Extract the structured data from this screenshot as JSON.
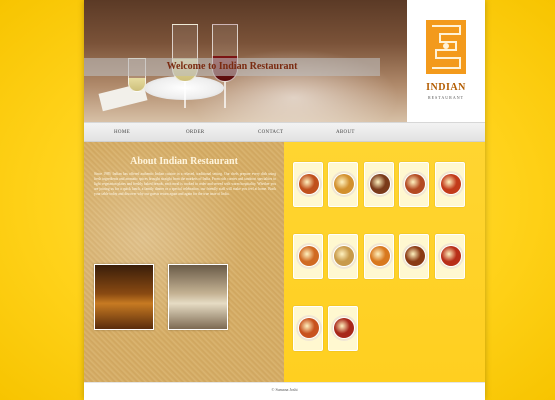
{
  "header": {
    "welcome": "Welcome to Indian Restaurant",
    "logo_title": "INDIAN",
    "logo_sub": "RESTAURANT"
  },
  "nav": {
    "items": [
      {
        "label": "HOME"
      },
      {
        "label": "ORDER"
      },
      {
        "label": "CONTACT"
      },
      {
        "label": "ABOUT"
      }
    ]
  },
  "about": {
    "title": "About Indian Restaurant",
    "text": "Since 1989, Indian has offered authentic Indian cuisine in a relaxed, traditional setting. Our chefs prepare every dish using fresh ingredients and aromatic spices brought straight from the markets of India. From rich curries and tandoori specialties to light vegetarian plates and freshly baked breads, each meal is cooked to order and served with warm hospitality. Whether you are joining us for a quick lunch, a family dinner or a special celebration, our friendly staff will make you feel at home. Book your table today and discover why our guests return again and again for the true taste of India."
  },
  "gallery": {
    "dishes": [
      {
        "name": "dish-1",
        "color": "#c0501c"
      },
      {
        "name": "dish-2",
        "color": "#d2902e"
      },
      {
        "name": "dish-3",
        "color": "#7a3a1a"
      },
      {
        "name": "dish-4",
        "color": "#b34a22"
      },
      {
        "name": "dish-5",
        "color": "#c23a1a"
      },
      {
        "name": "dish-6",
        "color": "#d06a22"
      },
      {
        "name": "dish-7",
        "color": "#c89a4a"
      },
      {
        "name": "dish-8",
        "color": "#d8781e"
      },
      {
        "name": "dish-9",
        "color": "#8a3a14"
      },
      {
        "name": "dish-10",
        "color": "#b82e18"
      },
      {
        "name": "dish-11",
        "color": "#c8521e"
      },
      {
        "name": "dish-12",
        "color": "#a8281a"
      }
    ]
  },
  "footer": {
    "text": "© Sumana Joshi"
  }
}
